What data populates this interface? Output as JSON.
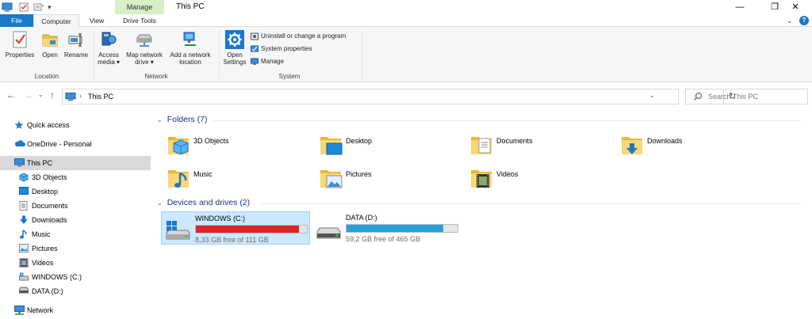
{
  "window": {
    "title": "This PC",
    "contextual_tab_group": "Manage",
    "controls": {
      "minimize": "—",
      "maximize": "❐",
      "close": "✕"
    }
  },
  "quick_access_toolbar": {
    "dropdown": "▾"
  },
  "tabs": [
    {
      "label": "File"
    },
    {
      "label": "Computer"
    },
    {
      "label": "View"
    },
    {
      "label": "Drive Tools"
    }
  ],
  "ribbon": {
    "collapse": "⌄",
    "help": "?",
    "groups": {
      "location": {
        "label": "Location",
        "buttons": [
          {
            "label": "Properties",
            "icon": "properties-icon"
          },
          {
            "label": "Open",
            "icon": "open-icon"
          },
          {
            "label": "Rename",
            "icon": "rename-icon"
          }
        ]
      },
      "network": {
        "label": "Network",
        "buttons": [
          {
            "label": "Access\nmedia ▾",
            "line1": "Access",
            "line2": "media ▾",
            "icon": "access-media-icon"
          },
          {
            "label": "Map network\ndrive ▾",
            "line1": "Map network",
            "line2": "drive ▾",
            "icon": "map-drive-icon"
          },
          {
            "label": "Add a network\nlocation",
            "line1": "Add a network",
            "line2": "location",
            "icon": "network-location-icon"
          }
        ]
      },
      "system": {
        "label": "System",
        "open_settings": {
          "line1": "Open",
          "line2": "Settings",
          "icon": "settings-gear-icon"
        },
        "small_buttons": [
          {
            "label": "Uninstall or change a program",
            "icon": "uninstall-icon"
          },
          {
            "label": "System properties",
            "icon": "system-properties-icon"
          },
          {
            "label": "Manage",
            "icon": "manage-icon"
          }
        ]
      }
    }
  },
  "address_bar": {
    "back": "←",
    "forward": "→",
    "recent": "⌄",
    "up": "↑",
    "separator": "›",
    "path": "This PC",
    "dropdown": "⌄",
    "refresh": "↻",
    "search_placeholder": "Search This PC"
  },
  "nav_pane": {
    "items": [
      {
        "label": "Quick access",
        "icon": "star-icon"
      },
      {
        "label": "OneDrive - Personal",
        "icon": "cloud-icon"
      },
      {
        "label": "This PC",
        "icon": "pc-icon"
      },
      {
        "label": "3D Objects",
        "icon": "cube-icon"
      },
      {
        "label": "Desktop",
        "icon": "desktop-icon"
      },
      {
        "label": "Documents",
        "icon": "documents-icon"
      },
      {
        "label": "Downloads",
        "icon": "download-arrow-icon"
      },
      {
        "label": "Music",
        "icon": "music-note-icon"
      },
      {
        "label": "Pictures",
        "icon": "pictures-icon"
      },
      {
        "label": "Videos",
        "icon": "videos-icon"
      },
      {
        "label": "WINDOWS (C:)",
        "icon": "windows-drive-icon"
      },
      {
        "label": "DATA (D:)",
        "icon": "drive-icon"
      },
      {
        "label": "Network",
        "icon": "network-icon"
      }
    ]
  },
  "content": {
    "folders_header": "Folders (7)",
    "folders": [
      {
        "label": "3D Objects",
        "icon": "folder-3d-objects-icon"
      },
      {
        "label": "Desktop",
        "icon": "folder-desktop-icon"
      },
      {
        "label": "Documents",
        "icon": "folder-documents-icon"
      },
      {
        "label": "Downloads",
        "icon": "folder-downloads-icon"
      },
      {
        "label": "Music",
        "icon": "folder-music-icon"
      },
      {
        "label": "Pictures",
        "icon": "folder-pictures-icon"
      },
      {
        "label": "Videos",
        "icon": "folder-videos-icon"
      }
    ],
    "drives_header": "Devices and drives (2)",
    "drives": [
      {
        "label": "WINDOWS (C:)",
        "free_text": "8,33 GB free of 111 GB",
        "used_fraction": 0.925,
        "bar_color": "#da2626",
        "selected": true
      },
      {
        "label": "DATA (D:)",
        "free_text": "59,2 GB free of 465 GB",
        "used_fraction": 0.873,
        "bar_color": "#26a0da",
        "selected": false
      }
    ]
  },
  "colors": {
    "accent": "#1979ca",
    "section_header": "#1e3287",
    "selection": "#cce8ff",
    "manage_tab": "#d6efc6",
    "folder_yellow": "#f8d775"
  }
}
